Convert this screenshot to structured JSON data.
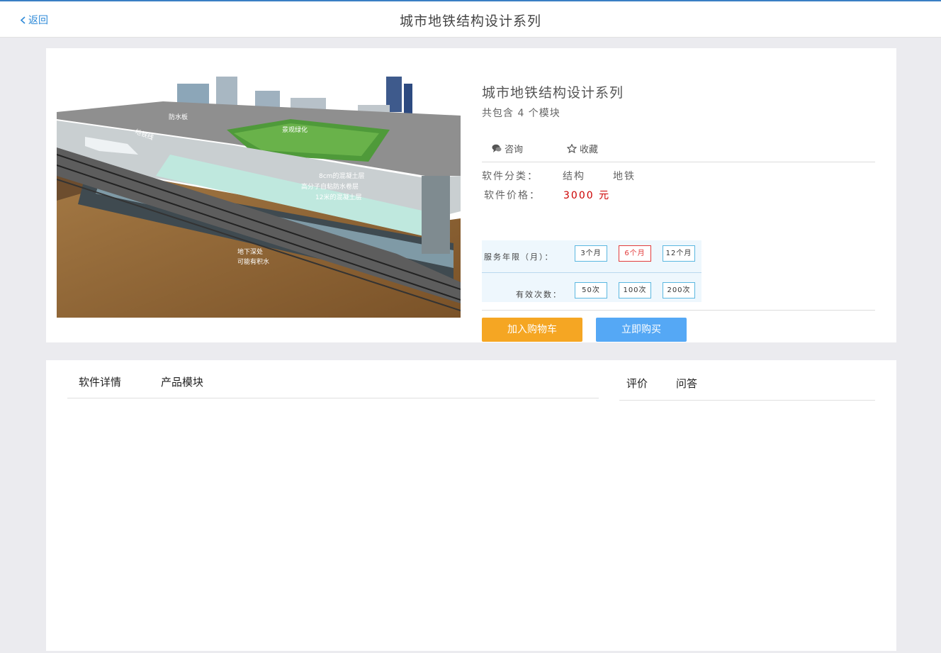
{
  "header": {
    "back_label": "返回",
    "title": "城市地铁结构设计系列"
  },
  "product": {
    "name": "城市地铁结构设计系列",
    "module_count_text": "共包含 4 个模块",
    "image_labels": {
      "label_1": "防水板",
      "label_2": "地铁线",
      "label_3": "景观绿化",
      "label_4": "8cm的混凝土层",
      "label_5": "高分子自粘防水卷层",
      "label_6": "12米的混凝土层",
      "label_7": "地下深处",
      "label_8": "可能有积水"
    },
    "actions": {
      "consult": "咨询",
      "favorite": "收藏"
    },
    "category_label": "软件分类：",
    "categories": [
      "结构",
      "地铁"
    ],
    "price_label": "软件价格：",
    "price_value": "3000 元",
    "service_label": "服务年限（月）：",
    "service_options": [
      "3个月",
      "6个月",
      "12个月"
    ],
    "service_selected": "6个月",
    "uses_label": "有效次数：",
    "uses_options": [
      "50次",
      "100次",
      "200次"
    ],
    "cart_button": "加入购物车",
    "buy_button": "立即购买"
  },
  "detail": {
    "tabs_left": [
      "软件详情",
      "产品模块"
    ],
    "tabs_right": [
      "评价",
      "问答"
    ]
  },
  "colors": {
    "accent_blue": "#2e8ad8",
    "price_red": "#cc0000",
    "cart_orange": "#f5a623",
    "buy_blue": "#55a8f5",
    "selected_red": "#e23b3b"
  }
}
